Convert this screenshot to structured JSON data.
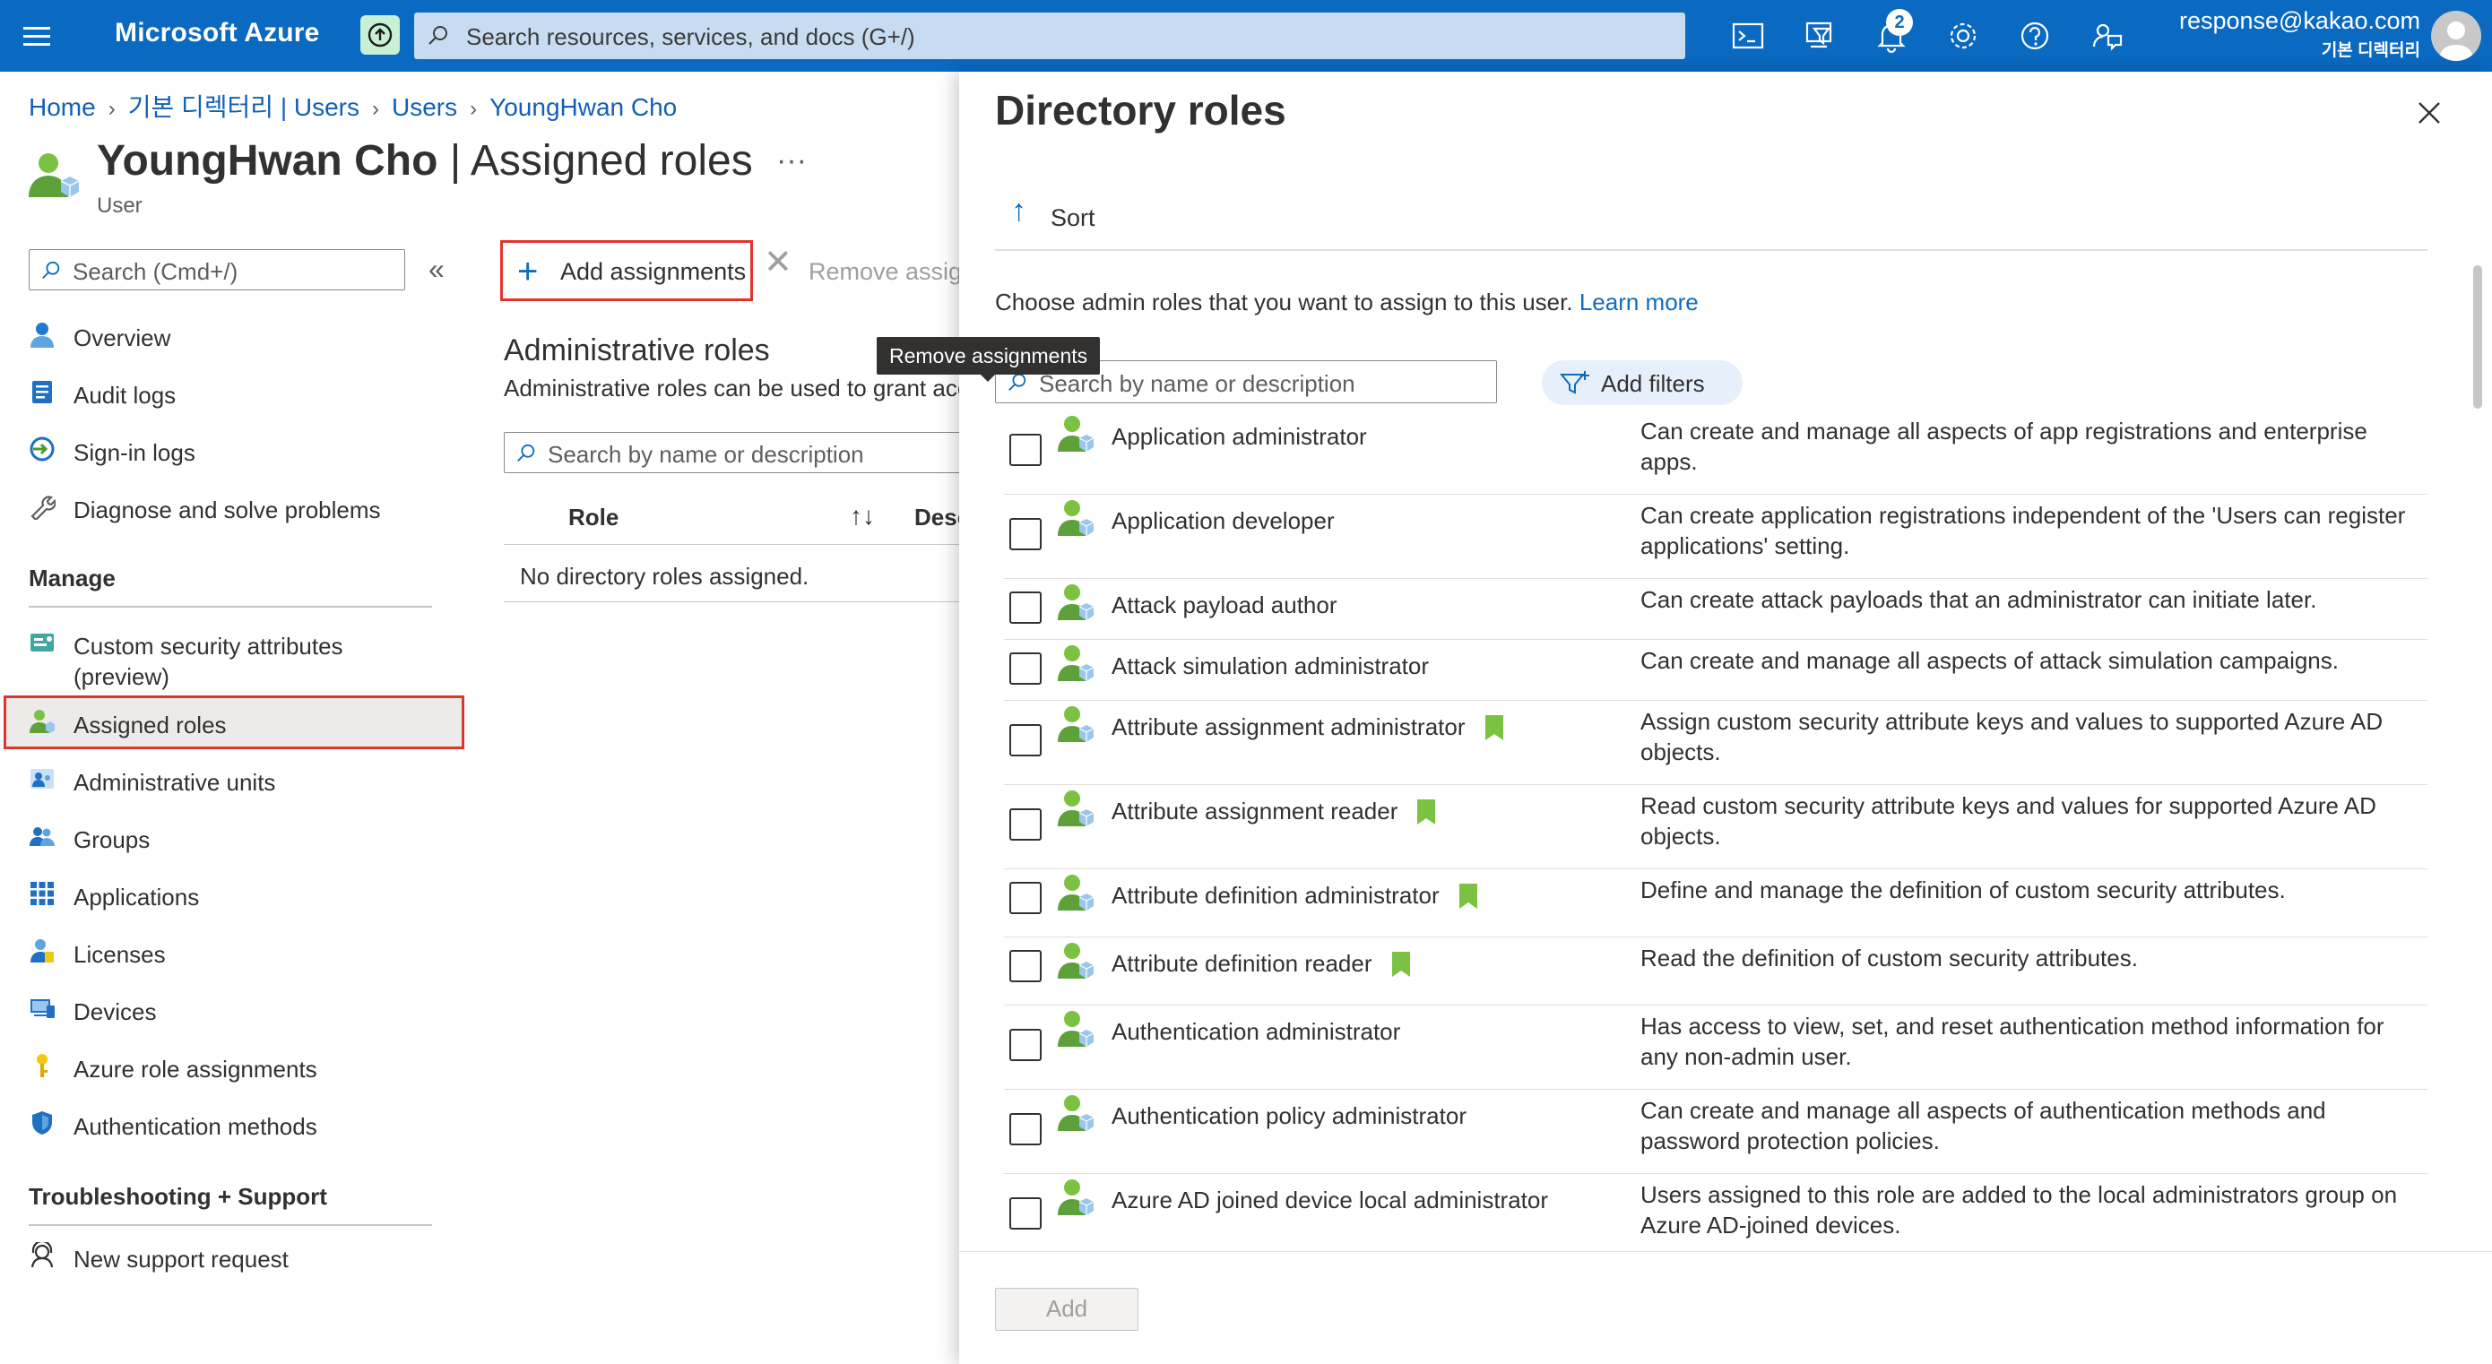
{
  "topbar": {
    "brand": "Microsoft Azure",
    "search_placeholder": "Search resources, services, and docs (G+/)",
    "notification_count": "2",
    "user_email": "response@kakao.com",
    "user_tenant": "기본 디렉터리",
    "icons": [
      "menu-icon",
      "upgrade-icon",
      "search-icon",
      "cloud-shell-icon",
      "directory-filter-icon",
      "bell-icon",
      "gear-icon",
      "help-icon",
      "feedback-icon",
      "avatar"
    ]
  },
  "breadcrumb": [
    "Home",
    "기본 디렉터리 | Users",
    "Users",
    "YoungHwan Cho"
  ],
  "page": {
    "title_name": "YoungHwan Cho",
    "title_suffix": " | Assigned roles",
    "ellipsis": "···",
    "subtitle": "User"
  },
  "sidebar": {
    "search_placeholder": "Search (Cmd+/)",
    "collapse_glyph": "«",
    "items_top": [
      {
        "label": "Overview",
        "icon": "user-icon"
      },
      {
        "label": "Audit logs",
        "icon": "audit-log-icon"
      },
      {
        "label": "Sign-in logs",
        "icon": "sign-in-icon"
      },
      {
        "label": "Diagnose and solve problems",
        "icon": "wrench-icon"
      }
    ],
    "manage_heading": "Manage",
    "items_manage": [
      {
        "label": "Custom security attributes",
        "label2": "(preview)",
        "icon": "security-attributes-icon"
      },
      {
        "label": "Assigned roles",
        "icon": "assigned-roles-icon"
      },
      {
        "label": "Administrative units",
        "icon": "admin-units-icon"
      },
      {
        "label": "Groups",
        "icon": "groups-icon"
      },
      {
        "label": "Applications",
        "icon": "applications-icon"
      },
      {
        "label": "Licenses",
        "icon": "licenses-icon"
      },
      {
        "label": "Devices",
        "icon": "devices-icon"
      },
      {
        "label": "Azure role assignments",
        "icon": "key-icon"
      },
      {
        "label": "Authentication methods",
        "icon": "shield-icon"
      }
    ],
    "support_heading": "Troubleshooting + Support",
    "items_support": [
      {
        "label": "New support request",
        "icon": "support-icon"
      }
    ]
  },
  "commands": {
    "add": "Add assignments",
    "remove": "Remove assignments",
    "tooltip": "Remove assignments"
  },
  "content": {
    "section_title": "Administrative roles",
    "section_desc": "Administrative roles can be used to grant access to Azure AD and other Microsoft services.",
    "search_placeholder": "Search by name or description",
    "col_role": "Role",
    "col_desc": "Description",
    "sort_glyph": "↑↓",
    "empty": "No directory roles assigned."
  },
  "panel": {
    "title": "Directory roles",
    "sort": "Sort",
    "intro": "Choose admin roles that you want to assign to this user. ",
    "learn_more": "Learn more",
    "search_placeholder": "Search by name or description",
    "add_filters": "Add filters",
    "add_button": "Add",
    "roles": [
      {
        "name": "Application administrator",
        "desc": "Can create and manage all aspects of app registrations and enterprise apps.",
        "preview": false
      },
      {
        "name": "Application developer",
        "desc": "Can create application registrations independent of the 'Users can register applications' setting.",
        "preview": false
      },
      {
        "name": "Attack payload author",
        "desc": "Can create attack payloads that an administrator can initiate later.",
        "preview": false
      },
      {
        "name": "Attack simulation administrator",
        "desc": "Can create and manage all aspects of attack simulation campaigns.",
        "preview": false
      },
      {
        "name": "Attribute assignment administrator",
        "desc": "Assign custom security attribute keys and values to supported Azure AD objects.",
        "preview": true
      },
      {
        "name": "Attribute assignment reader",
        "desc": "Read custom security attribute keys and values for supported Azure AD objects.",
        "preview": true
      },
      {
        "name": "Attribute definition administrator",
        "desc": "Define and manage the definition of custom security attributes.",
        "preview": true
      },
      {
        "name": "Attribute definition reader",
        "desc": "Read the definition of custom security attributes.",
        "preview": true
      },
      {
        "name": "Authentication administrator",
        "desc": "Has access to view, set, and reset authentication method information for any non-admin user.",
        "preview": false
      },
      {
        "name": "Authentication policy administrator",
        "desc": "Can create and manage all aspects of authentication methods and password protection policies.",
        "preview": false
      },
      {
        "name": "Azure AD joined device local administrator",
        "desc": "Users assigned to this role are added to the local administrators group on Azure AD-joined devices.",
        "preview": false
      }
    ]
  },
  "colors": {
    "topbar": "#0a69c1",
    "link": "#0f6cbd",
    "highlight_border": "#e0352b",
    "preview_badge": "#7cc242"
  }
}
